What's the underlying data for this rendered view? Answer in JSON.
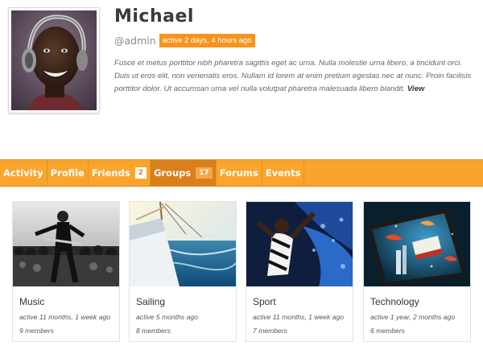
{
  "profile": {
    "name": "Michael",
    "handle": "@admin",
    "active_status": "active 2 days, 4 hours ago",
    "bio": "Fusce et metus porttitor nibh pharetra sagittis eget ac urna. Nulla molestie urna libero, a tincidunt orci. Duis ut eros elit, non venenatis eros. Nullam id lorem at enim pretium egestas nec at nunc. Proin facilisis porttitor dolor. Ut accumsan urna vel nulla volutpat pharetra malesuada libero blandit.",
    "view_link": "View"
  },
  "tabs": [
    {
      "label": "Activity",
      "count": null,
      "active": false
    },
    {
      "label": "Profile",
      "count": null,
      "active": false
    },
    {
      "label": "Friends",
      "count": "2",
      "active": false
    },
    {
      "label": "Groups",
      "count": "17",
      "active": true
    },
    {
      "label": "Forums",
      "count": null,
      "active": false
    },
    {
      "label": "Events",
      "count": null,
      "active": false
    }
  ],
  "groups": [
    {
      "name": "Music",
      "active": "active 11 months, 1 week ago",
      "members": "9 members",
      "image_icon": "concert-crowd-image"
    },
    {
      "name": "Sailing",
      "active": "active 5 months ago",
      "members": "8 members",
      "image_icon": "sailboat-sea-image"
    },
    {
      "name": "Sport",
      "active": "active 11 months, 1 week ago",
      "members": "7 members",
      "image_icon": "athlete-splash-image"
    },
    {
      "name": "Technology",
      "active": "active 1 year, 2 months ago",
      "members": "6 members",
      "image_icon": "tablet-fantasy-image"
    }
  ],
  "colors": {
    "tab_bar": "#f9a52d",
    "tab_active": "#d9801a",
    "badge": "#f7941d"
  }
}
